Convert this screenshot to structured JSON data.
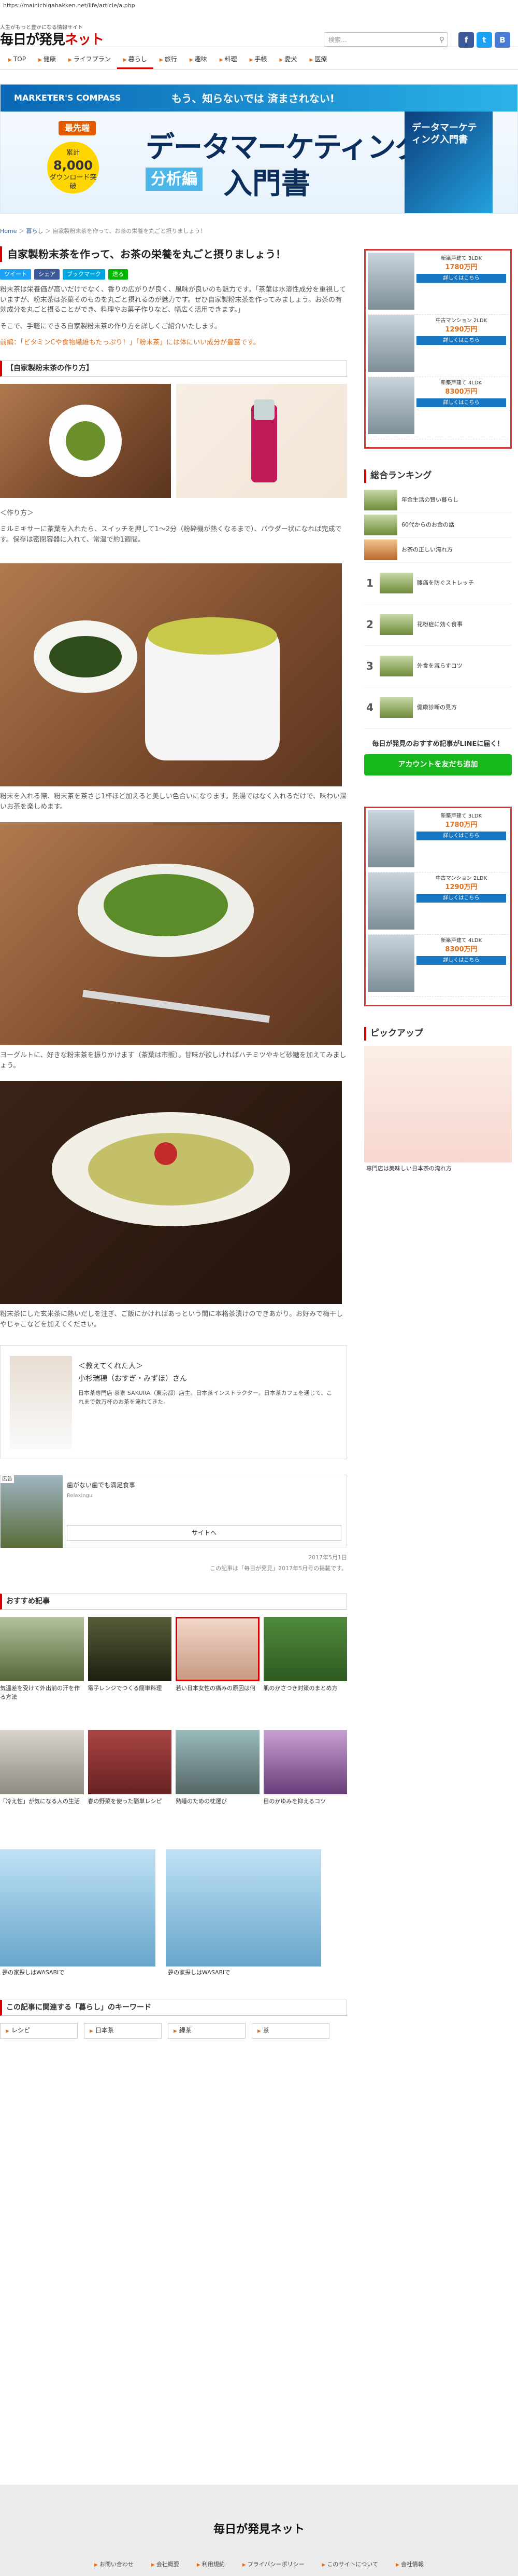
{
  "browser": {
    "url": "https://mainichigahakken.net/life/article/a.php"
  },
  "header": {
    "tagline": "人生がもっと豊かになる情報サイト",
    "logo_main": "毎日が発見",
    "logo_net": "ネット",
    "search_placeholder": "検索..."
  },
  "nav": [
    "TOP",
    "健康",
    "ライフプラン",
    "暮らし",
    "旅行",
    "趣味",
    "料理",
    "手帳",
    "愛犬",
    "医療"
  ],
  "banner": {
    "brand": "MARKETER'S COMPASS",
    "tagline": "もう、知らないでは 済まされない!",
    "badge": "最先端",
    "title": "データマーケティング",
    "sub1": "分析編",
    "sub2": "入門書",
    "circle_top": "累計",
    "circle_num": "8,000",
    "circle_bottom": "ダウンロード突破",
    "book": "データマーケティング入門書"
  },
  "crumb": {
    "home": "Home",
    "sep1": " ＞ ",
    "cat": "暮らし",
    "sep2": " ＞ ",
    "page": "自家製粉末茶を作って、お茶の栄養を丸ごと摂りましょう！"
  },
  "article": {
    "title": "自家製粉末茶を作って、お茶の栄養を丸ごと摂りましょう！",
    "shares": [
      "ツイート",
      "シェア",
      "ブックマーク",
      "送る"
    ],
    "intro": "粉末茶は栄養価が高いだけでなく、香りの広がりが良く、風味が良いのも魅力です。「茶葉は水溶性成分を重視していますが、粉末茶は茶葉そのものを丸ごと摂れるのが魅力です。ぜひ自家製粉末茶を作ってみましょう。お茶の有効成分を丸ごと摂ることができ、料理やお菓子作りなど、幅広く活用できます。」",
    "intro2": "そこで、手軽にできる自家製粉末茶の作り方を詳しくご紹介いたします。",
    "link": "前編：「ビタミンCや食物繊維もたっぷり！」「粉末茶」には体にいい成分が豊富です。",
    "sect": "【自家製粉末茶の作り方】",
    "howto": "＜作り方＞",
    "howto_text": "ミルミキサーに茶葉を入れたら、スイッチを押して1〜2分（粉砕機が熱くなるまで）、パウダー状になれば完成です。保存は密閉容器に入れて、常温で約1週間。",
    "cap1": "粉末を入れる際、粉末茶を茶さじ1杯ほど加えると美しい色合いになります。熱湯ではなく入れるだけで、味わい深いお茶を楽しめます。",
    "cap2": "ヨーグルトに、好きな粉末茶を振りかけます（茶葉は市販）。甘味が欲しければハチミツやキビ砂糖を加えてみましょう。",
    "cap3": "粉末茶にした玄米茶に熱いだしを注ぎ、ご飯にかければあっという間に本格茶漬けのできあがり。お好みで梅干しやじゃこなどを加えてください。"
  },
  "profile": {
    "label": "＜教えてくれた人＞",
    "name": "小杉瑞穂（おすぎ・みずほ）さん",
    "desc": "日本茶専門店 茶寮 SAKURA（東京都）店主。日本茶インストラクター。日本茶カフェを通じて、これまで数万杯のお茶を淹れてきた。"
  },
  "ad": {
    "label": "広告",
    "text": "歯がない歯でも満足食事",
    "source": "Relaxingu",
    "cta": "サイトへ"
  },
  "date": "2017年5月1日",
  "src": "この記事は「毎日が発見」2017年5月号の掲載です。",
  "recs_head": "おすすめ記事",
  "recs": [
    "気温差を受けて外出前の汗を作る方法",
    "電子レンジでつくる簡単料理",
    "若い日本女性の痛みの原因は何",
    "肌のかさつき対策のまとめ方",
    "「冷え性」が気になる人の生活",
    "春の野菜を使った簡単レシピ",
    "熟睡のための枕選び",
    "目のかゆみを抑えるコツ",
    "夢の家探しはWASABIで",
    "夢の家探しはWASABIで"
  ],
  "keywords_head": "この記事に関連する「暮らし」のキーワード",
  "keywords": [
    "レシピ",
    "日本茶",
    "緑茶",
    "茶"
  ],
  "sidebar": {
    "props": [
      {
        "t": "新築戸建て 3LDK",
        "p": "1780万円"
      },
      {
        "t": "中古マンション 2LDK",
        "p": "1290万円"
      },
      {
        "t": "新築戸建て 4LDK",
        "p": "8300万円"
      }
    ],
    "ranking_head": "総合ランキング",
    "ranking": [
      "年金生活の賢い暮らし",
      "60代からのお金の話",
      "お茶の正しい淹れ方",
      "腰痛を防ぐストレッチ",
      "花粉症に効く食事",
      "外食を減らすコツ",
      "健康診断の見方"
    ],
    "line_head": "毎日が発見のおすすめ記事がLINEに届く！",
    "line_btn": "アカウントを友だち追加",
    "pick_head": "ピックアップ",
    "pick_cap": "専門店は美味しい日本茶の淹れ方"
  },
  "footer": {
    "logo": "毎日が発見ネット",
    "links": [
      "お問い合わせ",
      "会社概要",
      "利用規約",
      "プライバシーポリシー",
      "このサイトについて",
      "会社情報"
    ]
  }
}
